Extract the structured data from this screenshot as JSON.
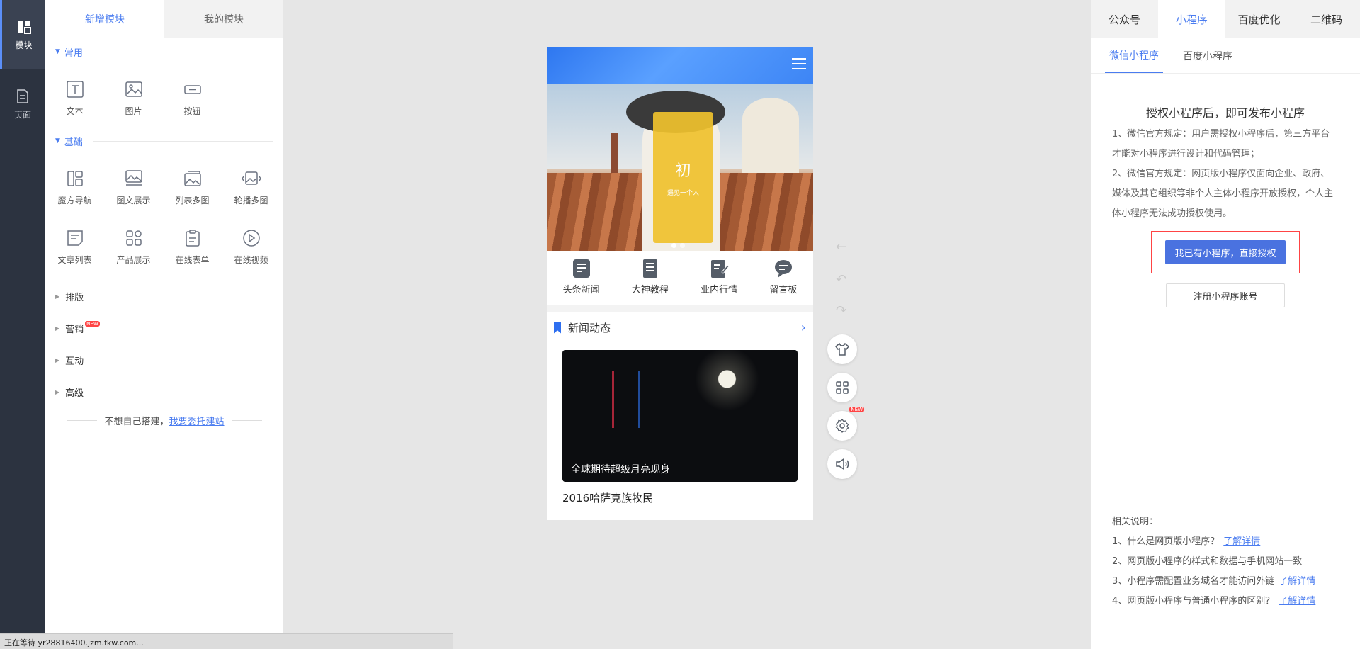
{
  "rail": {
    "items": [
      {
        "label": "模块",
        "icon": "module-icon",
        "active": true
      },
      {
        "label": "页面",
        "icon": "page-icon",
        "active": false
      }
    ]
  },
  "panel": {
    "tabs": [
      "新增模块",
      "我的模块"
    ],
    "groups": {
      "common": {
        "title": "常用",
        "items": [
          {
            "label": "文本",
            "icon": "text-icon"
          },
          {
            "label": "图片",
            "icon": "image-icon"
          },
          {
            "label": "按钮",
            "icon": "button-icon"
          }
        ]
      },
      "basic": {
        "title": "基础",
        "items": [
          {
            "label": "魔方导航",
            "icon": "cube-nav-icon"
          },
          {
            "label": "图文展示",
            "icon": "image-text-icon"
          },
          {
            "label": "列表多图",
            "icon": "list-images-icon"
          },
          {
            "label": "轮播多图",
            "icon": "carousel-icon"
          },
          {
            "label": "文章列表",
            "icon": "article-list-icon"
          },
          {
            "label": "产品展示",
            "icon": "product-icon"
          },
          {
            "label": "在线表单",
            "icon": "form-icon"
          },
          {
            "label": "在线视频",
            "icon": "video-icon"
          }
        ]
      }
    },
    "collapsed": {
      "layout": "排版",
      "marketing": "营销",
      "interact": "互动",
      "advanced": "高级"
    },
    "new_badge": "NEW",
    "entrust_text": "不想自己搭建，",
    "entrust_link": "我要委托建站"
  },
  "phone": {
    "poster_big": "初",
    "poster_small": "遇见一个人",
    "quick_nav": [
      "头条新闻",
      "大神教程",
      "业内行情",
      "留言板"
    ],
    "news_header": "新闻动态",
    "news_caption": "全球期待超级月亮现身",
    "news_title": "2016哈萨克族牧民"
  },
  "float_tools": {
    "new_badge": "NEW"
  },
  "right": {
    "tabs": [
      "公众号",
      "小程序",
      "百度优化",
      "二维码"
    ],
    "subtabs": [
      "微信小程序",
      "百度小程序"
    ],
    "auth_title": "授权小程序后，即可发布小程序",
    "rules": [
      "1、微信官方规定：用户需授权小程序后，第三方平台才能对小程序进行设计和代码管理；",
      "2、微信官方规定：网页版小程序仅面向企业、政府、媒体及其它组织等非个人主体小程序开放授权，个人主体小程序无法成功授权使用。"
    ],
    "primary_button": "我已有小程序，直接授权",
    "register_button": "注册小程序账号",
    "notes_title": "相关说明：",
    "notes": [
      {
        "text": "1、什么是网页版小程序？",
        "link": "了解详情"
      },
      {
        "text": "2、网页版小程序的样式和数据与手机网站一致",
        "link": ""
      },
      {
        "text": "3、小程序需配置业务域名才能访问外链",
        "link": "了解详情"
      },
      {
        "text": "4、网页版小程序与普通小程序的区别？",
        "link": "了解详情"
      }
    ]
  },
  "status_text": "正在等待 yr28816400.jzm.fkw.com...",
  "colors": {
    "accent": "#4a7cf0",
    "rail": "#2c3340",
    "primary_button": "#4a72e0",
    "highlight_border": "#ff4444"
  }
}
